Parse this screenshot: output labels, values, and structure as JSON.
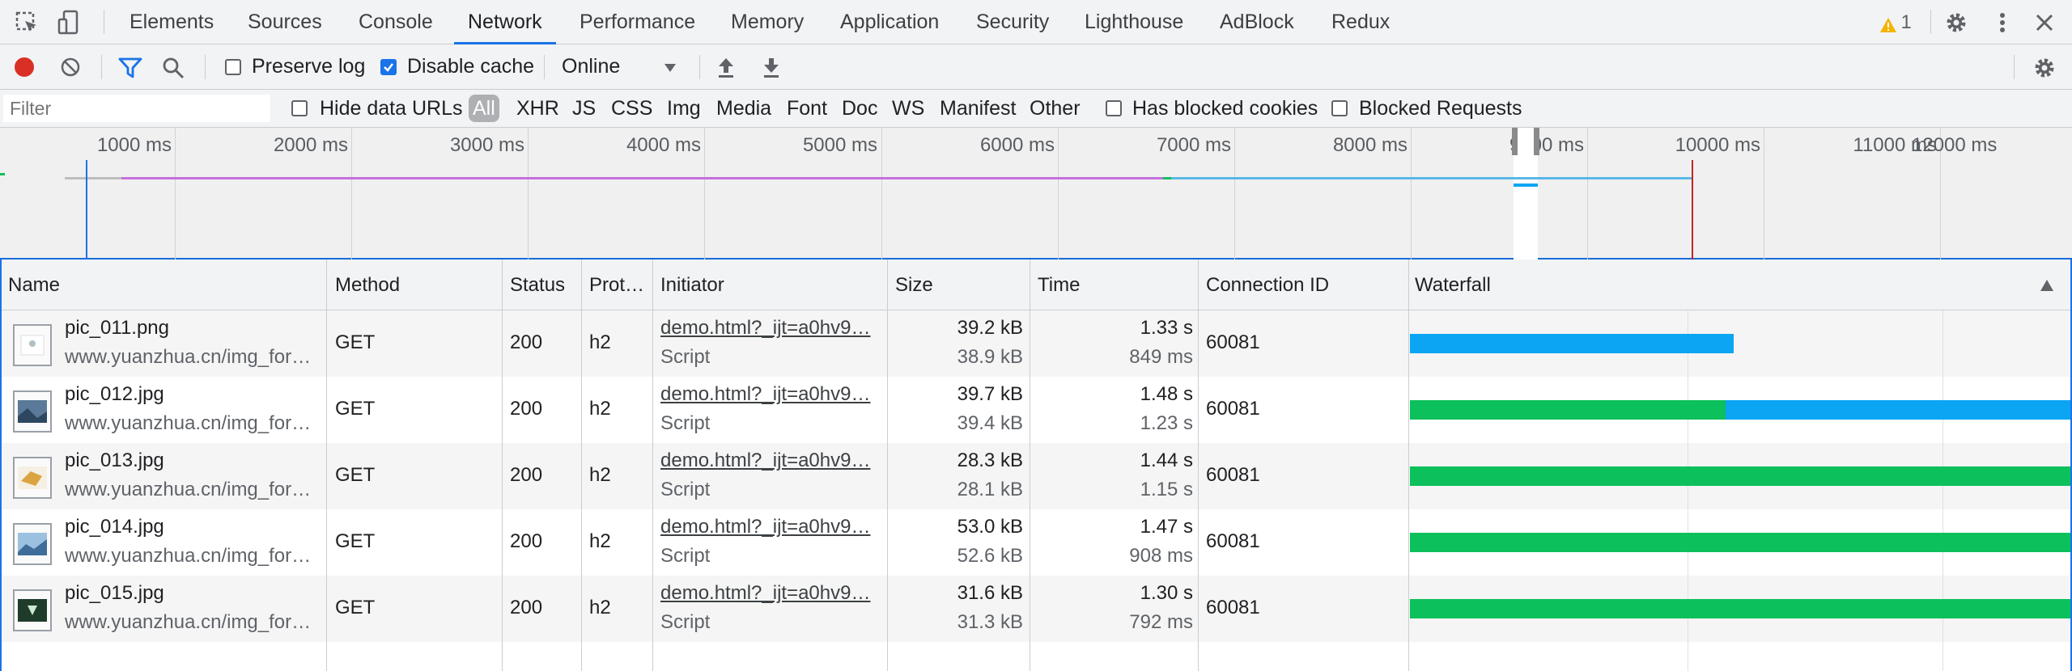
{
  "tabs": [
    "Elements",
    "Sources",
    "Console",
    "Network",
    "Performance",
    "Memory",
    "Application",
    "Security",
    "Lighthouse",
    "AdBlock",
    "Redux"
  ],
  "active_tab": "Network",
  "warning_count": "1",
  "toolbar": {
    "preserve_log": "Preserve log",
    "disable_cache": "Disable cache",
    "throttle": "Online"
  },
  "filterbar": {
    "filter_placeholder": "Filter",
    "hide_data_urls": "Hide data URLs",
    "types": [
      "All",
      "XHR",
      "JS",
      "CSS",
      "Img",
      "Media",
      "Font",
      "Doc",
      "WS",
      "Manifest",
      "Other"
    ],
    "has_blocked_cookies": "Has blocked cookies",
    "blocked_requests": "Blocked Requests"
  },
  "overview": {
    "ticks": [
      "1000 ms",
      "2000 ms",
      "3000 ms",
      "4000 ms",
      "5000 ms",
      "6000 ms",
      "7000 ms",
      "8000 ms",
      "9000 ms",
      "10000 ms",
      "11000 ms",
      "12000 ms"
    ]
  },
  "table": {
    "headers": {
      "name": "Name",
      "method": "Method",
      "status": "Status",
      "protocol": "Prot…",
      "initiator": "Initiator",
      "size": "Size",
      "time": "Time",
      "connection": "Connection ID",
      "waterfall": "Waterfall"
    },
    "rows": [
      {
        "name": "pic_011.png",
        "url": "www.yuanzhua.cn/img_for…",
        "method": "GET",
        "status": "200",
        "protocol": "h2",
        "initiator": "demo.html?_ijt=a0hv9…",
        "initiator_type": "Script",
        "size": "39.2 kB",
        "size_res": "38.9 kB",
        "time": "1.33 s",
        "latency": "849 ms",
        "connection": "60081"
      },
      {
        "name": "pic_012.jpg",
        "url": "www.yuanzhua.cn/img_for…",
        "method": "GET",
        "status": "200",
        "protocol": "h2",
        "initiator": "demo.html?_ijt=a0hv9…",
        "initiator_type": "Script",
        "size": "39.7 kB",
        "size_res": "39.4 kB",
        "time": "1.48 s",
        "latency": "1.23 s",
        "connection": "60081"
      },
      {
        "name": "pic_013.jpg",
        "url": "www.yuanzhua.cn/img_for…",
        "method": "GET",
        "status": "200",
        "protocol": "h2",
        "initiator": "demo.html?_ijt=a0hv9…",
        "initiator_type": "Script",
        "size": "28.3 kB",
        "size_res": "28.1 kB",
        "time": "1.44 s",
        "latency": "1.15 s",
        "connection": "60081"
      },
      {
        "name": "pic_014.jpg",
        "url": "www.yuanzhua.cn/img_for…",
        "method": "GET",
        "status": "200",
        "protocol": "h2",
        "initiator": "demo.html?_ijt=a0hv9…",
        "initiator_type": "Script",
        "size": "53.0 kB",
        "size_res": "52.6 kB",
        "time": "1.47 s",
        "latency": "908 ms",
        "connection": "60081"
      },
      {
        "name": "pic_015.jpg",
        "url": "www.yuanzhua.cn/img_for…",
        "method": "GET",
        "status": "200",
        "protocol": "h2",
        "initiator": "demo.html?_ijt=a0hv9…",
        "initiator_type": "Script",
        "size": "31.6 kB",
        "size_res": "31.3 kB",
        "time": "1.30 s",
        "latency": "792 ms",
        "connection": "60081"
      }
    ]
  },
  "colors": {
    "accent": "#1a73e8",
    "record": "#d93025",
    "waiting": "#0cc05b",
    "download": "#0ba5f4",
    "warning": "#f4b400"
  }
}
